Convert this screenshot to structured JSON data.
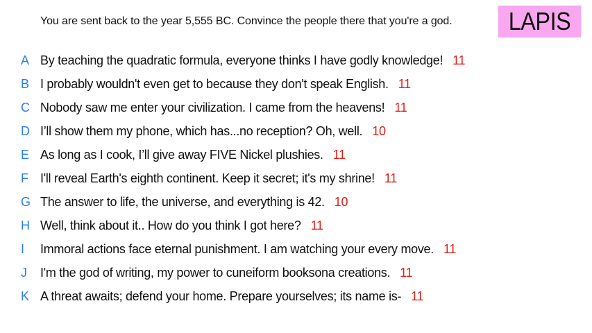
{
  "prompt": "You are sent back to the year 5,555 BC. Convince the people there that you're a god.",
  "player_tag": {
    "name": "LAPIS",
    "background": "#f9a8f0"
  },
  "colors": {
    "letter": "#2b7de9",
    "score": "#e0201b",
    "text": "#111111"
  },
  "answers": [
    {
      "letter": "A",
      "text": "By teaching the quadratic formula, everyone thinks I have godly knowledge!",
      "score": "11"
    },
    {
      "letter": "B",
      "text": "I probably wouldn't even get to because they don't speak English.",
      "score": "11"
    },
    {
      "letter": "C",
      "text": "Nobody saw me enter your civilization. I came from the heavens!",
      "score": "11"
    },
    {
      "letter": "D",
      "text": "I’ll show them my phone, which has...no reception? Oh, well.",
      "score": "10"
    },
    {
      "letter": "E",
      "text": "As long as I cook, I’ll give away FIVE Nickel plushies.",
      "score": "11"
    },
    {
      "letter": "F",
      "text": "I'll reveal Earth's eighth continent. Keep it secret; it's my shrine!",
      "score": "11"
    },
    {
      "letter": "G",
      "text": "The answer to life, the universe, and everything is 42.",
      "score": "10"
    },
    {
      "letter": "H",
      "text": "Well, think about it.. How do you think I got here?",
      "score": "11"
    },
    {
      "letter": "I",
      "text": "Immoral actions face eternal punishment. I am watching your every move.",
      "score": "11"
    },
    {
      "letter": "J",
      "text": "I'm the god of writing, my power to cuneiform booksona creations.",
      "score": "11"
    },
    {
      "letter": "K",
      "text": "A threat awaits; defend your home. Prepare yourselves; its name is-",
      "score": "11"
    }
  ]
}
